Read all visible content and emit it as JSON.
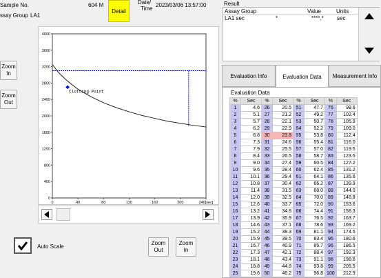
{
  "header": {
    "sample_no_label": "Sample No.",
    "sample_no_value": "604 M",
    "assay_group_label": "ssay Group",
    "assay_group_value": "LA1",
    "detail_button": "Detail",
    "date_label_line1": "Date/",
    "date_label_line2": "Time",
    "datetime_value": "2023/03/06 13:57:00"
  },
  "result": {
    "title": "Result",
    "columns": [
      "Assay Group",
      "Value",
      "Units"
    ],
    "rows": [
      {
        "assay": "LA1 sec",
        "flag": "*",
        "value": "****.*",
        "units": "sec"
      }
    ]
  },
  "tabs": [
    "Evaluation Info",
    "Evaluation Data",
    "Measurement Info"
  ],
  "active_tab": "Evaluation Data",
  "eval": {
    "title": "Evaluation Data",
    "col_pct": "%",
    "col_sec": "Sec",
    "highlight_pct": 30,
    "cols": [
      {
        "pct": [
          1,
          2,
          3,
          4,
          5,
          6,
          7,
          8,
          9,
          10,
          11,
          12,
          13,
          14,
          15,
          16,
          17,
          18,
          19,
          20,
          21,
          22,
          23,
          24,
          25
        ],
        "sec": [
          "4.6",
          "5.1",
          "5.7",
          "6.2",
          "6.8",
          "7.3",
          "7.9",
          "8.4",
          "9.0",
          "9.6",
          "10.1",
          "10.8",
          "11.4",
          "12.0",
          "12.6",
          "13.2",
          "13.9",
          "14.6",
          "15.2",
          "15.9",
          "16.7",
          "17.3",
          "18.1",
          "18.8",
          "19.6"
        ]
      },
      {
        "pct": [
          26,
          27,
          28,
          29,
          30,
          31,
          32,
          33,
          34,
          35,
          36,
          37,
          38,
          39,
          40,
          41,
          42,
          43,
          44,
          45,
          46,
          47,
          48,
          49,
          50
        ],
        "sec": [
          "20.5",
          "21.2",
          "22.1",
          "22.9",
          "23.8",
          "24.6",
          "25.5",
          "26.5",
          "27.4",
          "28.4",
          "29.4",
          "30.4",
          "31.5",
          "32.5",
          "33.7",
          "34.8",
          "35.9",
          "37.1",
          "38.3",
          "39.5",
          "40.9",
          "42.1",
          "43.4",
          "44.8",
          "46.2"
        ]
      },
      {
        "pct": [
          51,
          52,
          53,
          54,
          55,
          56,
          57,
          58,
          59,
          60,
          61,
          62,
          63,
          64,
          65,
          66,
          67,
          68,
          69,
          70,
          71,
          72,
          73,
          74,
          75
        ],
        "sec": [
          "47.7",
          "49.2",
          "50.7",
          "52.2",
          "53.8",
          "55.4",
          "57.0",
          "58.7",
          "60.5",
          "62.4",
          "64.1",
          "66.2",
          "68.0",
          "70.0",
          "72.0",
          "74.4",
          "76.5",
          "78.6",
          "81.1",
          "83.4",
          "85.7",
          "88.4",
          "91.1",
          "93.8",
          "96.8"
        ]
      },
      {
        "pct": [
          76,
          77,
          78,
          79,
          80,
          81,
          82,
          83,
          84,
          85,
          86,
          87,
          88,
          89,
          90,
          91,
          92,
          93,
          94,
          95,
          96,
          97,
          98,
          99,
          100
        ],
        "sec": [
          "99.6",
          "102.4",
          "105.9",
          "109.0",
          "112.4",
          "116.0",
          "119.5",
          "123.5",
          "127.2",
          "131.2",
          "135.6",
          "139.9",
          "144.0",
          "148.8",
          "153.6",
          "158.3",
          "163.7",
          "169.2",
          "174.5",
          "180.6",
          "186.5",
          "192.3",
          "198.6",
          "205.5",
          "212.9"
        ]
      }
    ]
  },
  "chart_data": {
    "type": "line",
    "xlim": [
      0,
      240
    ],
    "ylim": [
      0,
      4000
    ],
    "xticks": [
      "0",
      "40",
      "80",
      "120",
      "160",
      "200",
      "240[sec]"
    ],
    "yticks": [
      "0",
      "400",
      "800",
      "1200",
      "1600",
      "2000",
      "2400",
      "2800",
      "3200",
      "3600",
      "4000"
    ],
    "series": [
      {
        "x": [
          0,
          10,
          20,
          30,
          40,
          60,
          80,
          100,
          120,
          140,
          160,
          180,
          200,
          220,
          240
        ],
        "y": [
          3250,
          3050,
          2900,
          2770,
          2650,
          2470,
          2320,
          2200,
          2100,
          2010,
          1940,
          1870,
          1820,
          1770,
          1730
        ]
      }
    ],
    "annotations": [
      {
        "text": "Clotting Point",
        "x": 23.8,
        "y": 2700
      }
    ],
    "threshold_y": 3100,
    "marker_x": 212.9
  },
  "controls": {
    "zoom_in": "Zoom In",
    "zoom_out": "Zoom Out",
    "auto_scale": "Auto Scale",
    "zoom_out_line1": "Zoom",
    "zoom_out_line2": "Out",
    "zoom_in_line1": "Zoom",
    "zoom_in_line2": "In"
  },
  "colors": {
    "detail": "#ffff00",
    "highlight": "#f7b7b7",
    "pct_col": "#c7c7f0",
    "curve": "#222222",
    "guide": "#0000ff"
  }
}
